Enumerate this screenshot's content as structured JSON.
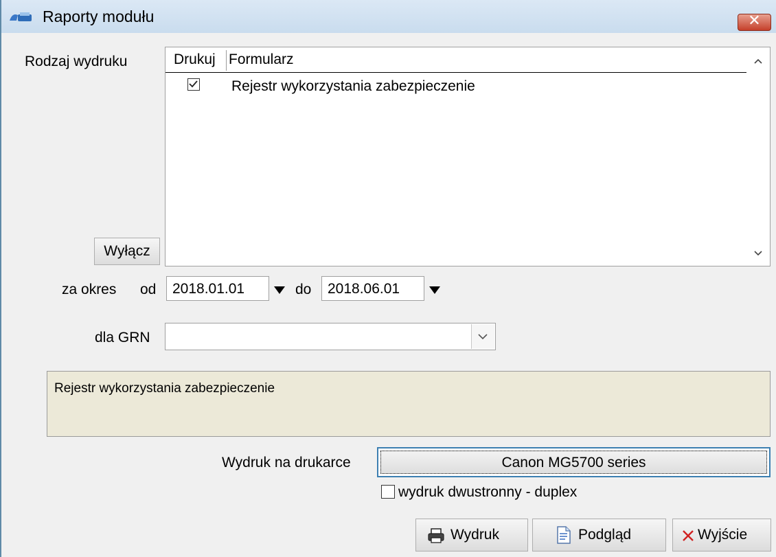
{
  "window": {
    "title": "Raporty modułu",
    "close_icon": "close-icon"
  },
  "report_type": {
    "label": "Rodzaj wydruku",
    "columns": [
      "Drukuj",
      "Formularz"
    ],
    "rows": [
      {
        "print": true,
        "form": "Rejestr wykorzystania zabezpieczenie"
      }
    ],
    "disable_button": "Wyłącz"
  },
  "period": {
    "label": "za okres",
    "from_label": "od",
    "from_value": "2018.01.01",
    "to_label": "do",
    "to_value": "2018.06.01"
  },
  "grn": {
    "label": "dla GRN",
    "value": ""
  },
  "description": "Rejestr wykorzystania zabezpieczenie",
  "printer": {
    "label": "Wydruk na drukarce",
    "name": "Canon MG5700 series"
  },
  "duplex": {
    "label": "wydruk dwustronny - duplex",
    "checked": false
  },
  "buttons": {
    "print": "Wydruk",
    "preview": "Podgląd",
    "exit": "Wyjście"
  },
  "colors": {
    "accent": "#3c7fb1",
    "description_bg": "#ece9d8",
    "close": "#c5402b"
  }
}
